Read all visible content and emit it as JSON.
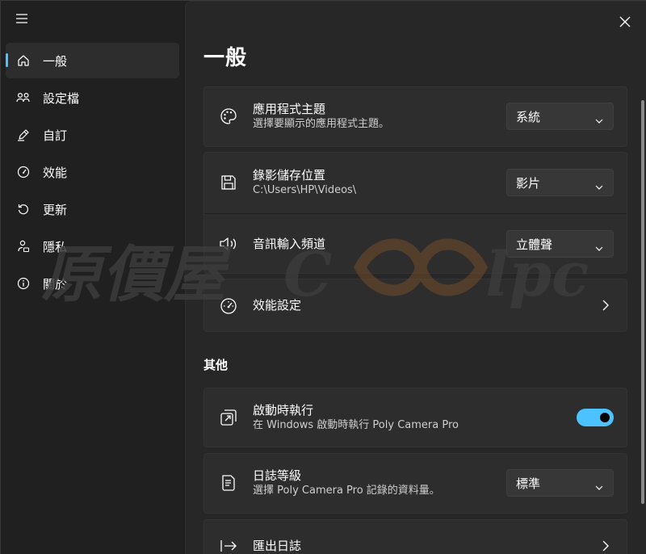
{
  "sidebar": {
    "menu_icon": "hamburger-icon",
    "items": [
      {
        "label": "一般",
        "icon": "home-icon",
        "active": true
      },
      {
        "label": "設定檔",
        "icon": "people-icon"
      },
      {
        "label": "自訂",
        "icon": "pen-icon"
      },
      {
        "label": "效能",
        "icon": "gauge-icon"
      },
      {
        "label": "更新",
        "icon": "refresh-icon"
      },
      {
        "label": "隱私",
        "icon": "person-lock-icon"
      },
      {
        "label": "關於",
        "icon": "info-icon"
      }
    ]
  },
  "main": {
    "title": "一般",
    "close_icon": "close-icon",
    "settings": {
      "theme": {
        "title": "應用程式主題",
        "subtitle": "選擇要顯示的應用程式主題。",
        "value": "系統",
        "icon": "palette-icon"
      },
      "save_location": {
        "title": "錄影儲存位置",
        "subtitle": "C:\\Users\\HP\\Videos\\",
        "value": "影片",
        "icon": "save-icon"
      },
      "audio_channel": {
        "title": "音訊輸入頻道",
        "value": "立體聲",
        "icon": "speaker-icon"
      },
      "performance": {
        "title": "效能設定",
        "icon": "gauge-icon"
      }
    },
    "other_section_title": "其他",
    "other": {
      "startup": {
        "title": "啟動時執行",
        "subtitle": "在 Windows 啟動時執行 Poly Camera Pro",
        "enabled": true,
        "icon": "startup-icon"
      },
      "log_level": {
        "title": "日誌等級",
        "subtitle": "選擇 Poly Camera Pro 記錄的資料量。",
        "value": "標準",
        "icon": "document-icon"
      },
      "export_log": {
        "title": "匯出日誌",
        "icon": "export-icon"
      }
    }
  },
  "watermark": {
    "text_cjk": "原價屋",
    "text_latin_1": "C",
    "text_latin_2": "lpc"
  },
  "colors": {
    "accent": "#4cc2ff",
    "background": "#202020",
    "card": "#2d2d2d"
  }
}
